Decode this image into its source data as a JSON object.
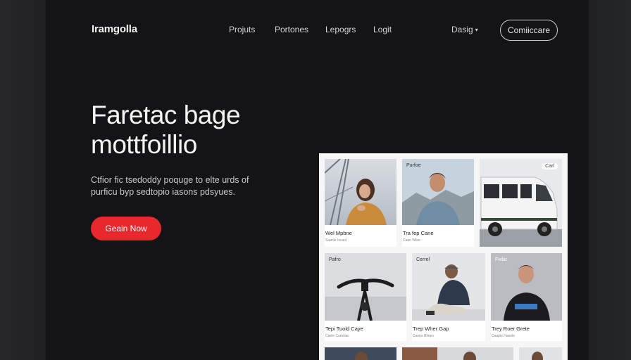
{
  "brand": "Iramgolla",
  "nav": {
    "links": [
      "Projuts",
      "Portones",
      "Lepogrs",
      "Logit"
    ],
    "dropdown_label": "Dasig",
    "contact_label": "Comiiccare"
  },
  "hero": {
    "title_line1": "Faretac bage",
    "title_line2": "mottfoillio",
    "subtitle_line1": "Ctfior fic tsedoddy poquge to elte urds of",
    "subtitle_line2": "purficu byp sedtopio iasons pdsyues.",
    "cta_label": "Geain Now"
  },
  "gallery": {
    "cards": [
      {
        "tag": "",
        "caption": "Wel Mpbne",
        "meta": "Saanle Iscanl"
      },
      {
        "tag": "Purfoe",
        "caption": "Tra fep Cane",
        "meta": "Caan Wlas"
      },
      {
        "tag": "Carl",
        "caption": "",
        "meta": ""
      },
      {
        "tag": "Pafro",
        "caption": "Tepi Tuold Caye",
        "meta": "Caele Cumslac"
      },
      {
        "tag": "Cerrel",
        "caption": "Trep Wher Gap",
        "meta": "Caene Blinen"
      },
      {
        "tag": "Fwlat",
        "caption": "Trey Roer Grete",
        "meta": "Caaple Haonle"
      }
    ]
  },
  "colors": {
    "background": "#141416",
    "accent": "#e8282d",
    "text": "#f4f4f5"
  }
}
